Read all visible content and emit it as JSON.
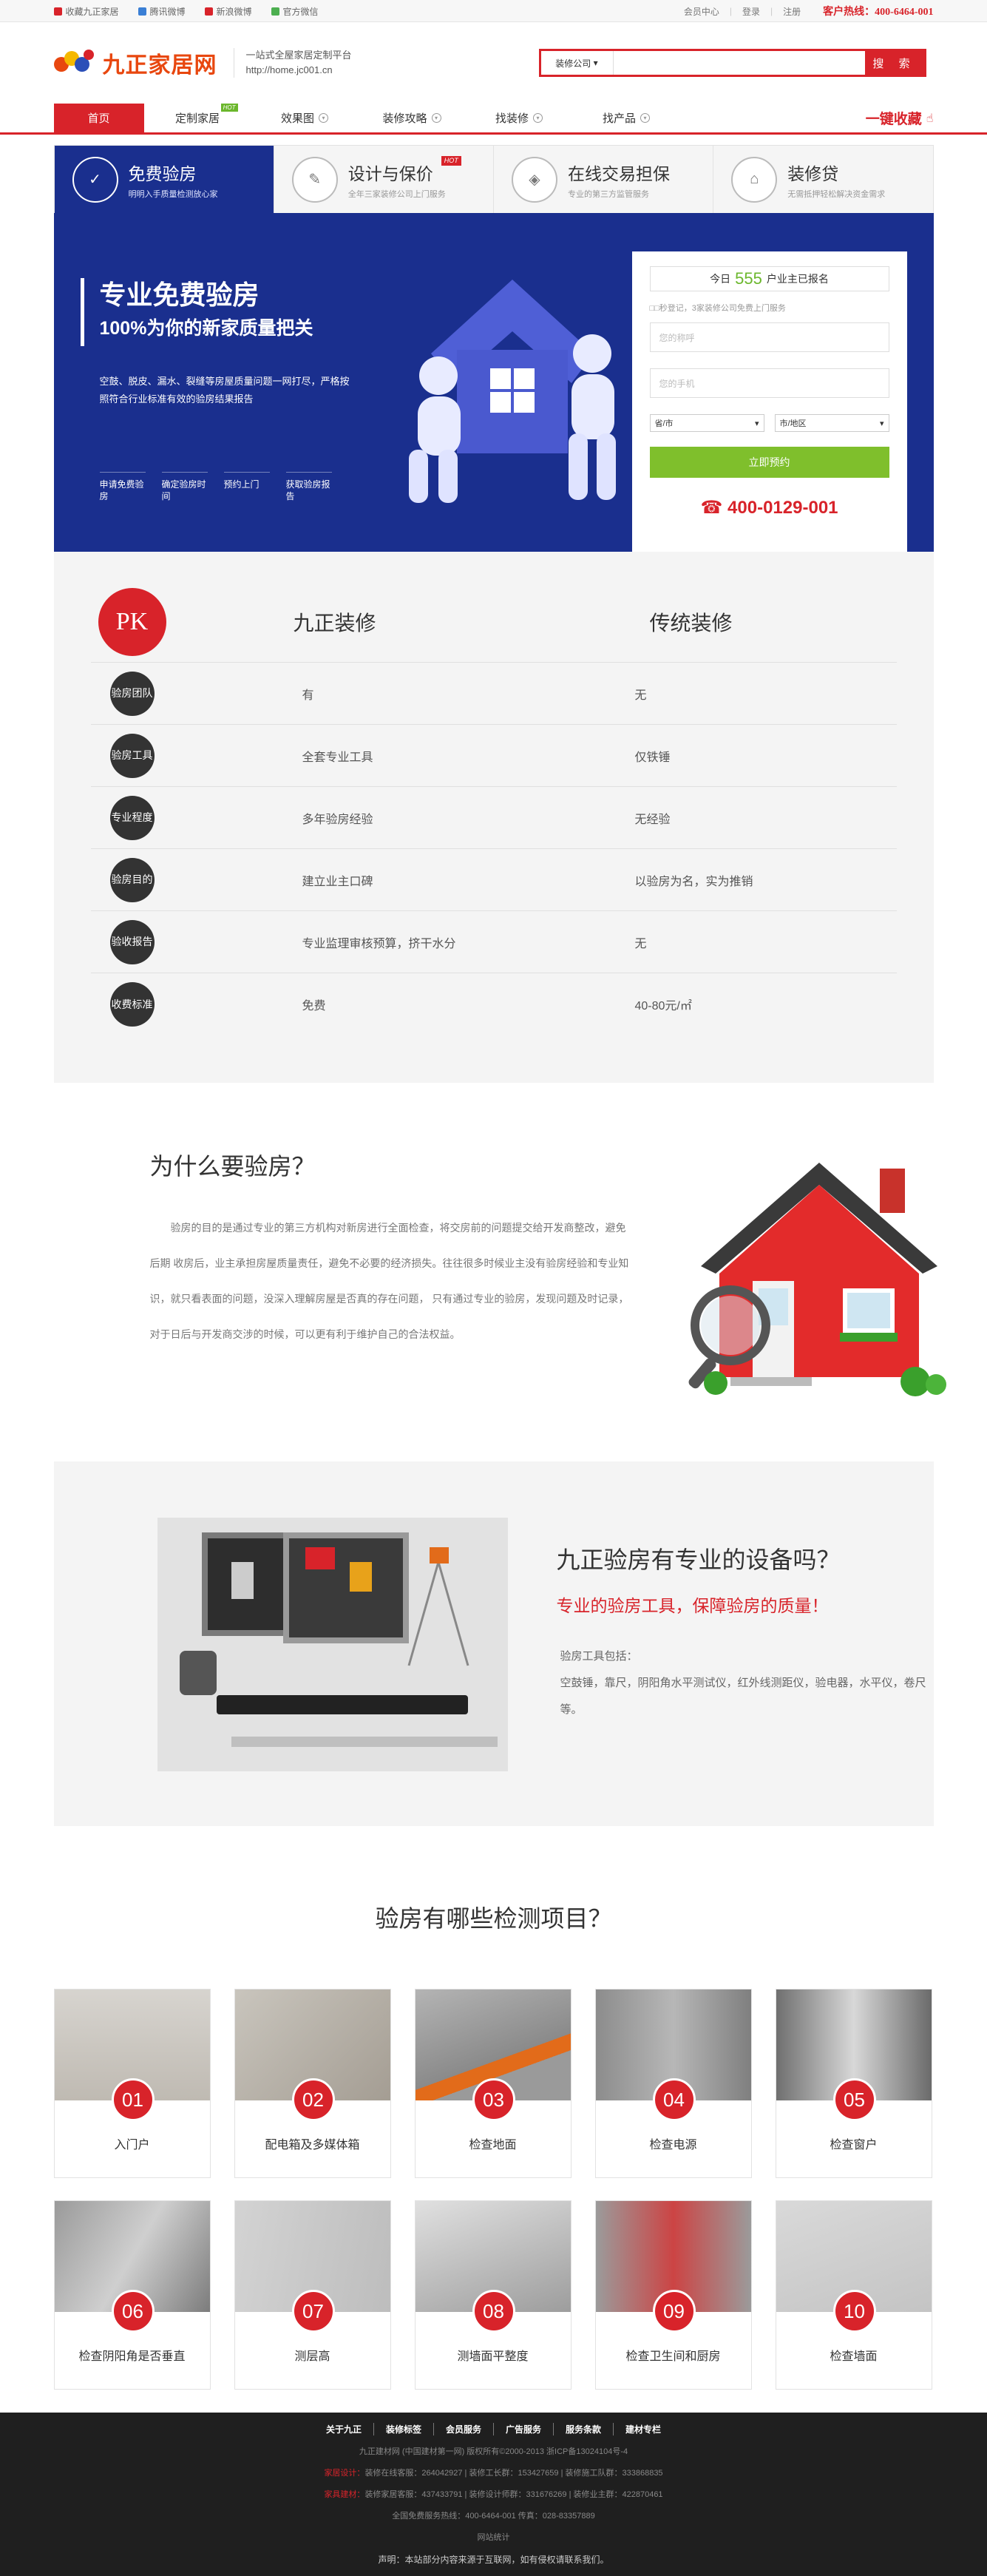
{
  "topbar": {
    "links": [
      {
        "label": "收藏九正家居",
        "color": "#d8232a"
      },
      {
        "label": "腾讯微博",
        "color": "#3a7fd5"
      },
      {
        "label": "新浪微博",
        "color": "#d8232a"
      },
      {
        "label": "官方微信",
        "color": "#4caf50"
      }
    ],
    "member_center": "会员中心",
    "login": "登录",
    "register": "注册",
    "hotline": "客户热线：400-6464-001"
  },
  "header": {
    "logo_text": "九正家居网",
    "slogan_1": "一站式全屋家居定制平台",
    "slogan_2": "http://home.jc001.cn",
    "search_select": "装修公司",
    "search_placeholder": "",
    "search_button": "搜 索"
  },
  "nav": {
    "items": [
      {
        "label": "首页"
      },
      {
        "label": "定制家居",
        "badge": "HOT"
      },
      {
        "label": "效果图"
      },
      {
        "label": "装修攻略"
      },
      {
        "label": "找装修"
      },
      {
        "label": "找产品"
      }
    ],
    "favorite": "一键收藏"
  },
  "service_tabs": [
    {
      "title": "免费验房",
      "sub": "明明入手质量检测放心家"
    },
    {
      "title": "设计与保价",
      "sub": "全年三家装修公司上门服务",
      "badge": "HOT"
    },
    {
      "title": "在线交易担保",
      "sub": "专业的第三方监管服务"
    },
    {
      "title": "装修贷",
      "sub": "无需抵押轻松解决资金需求"
    }
  ],
  "banner": {
    "title": "专业免费验房",
    "subtitle": "100%为你的新家质量把关",
    "desc": "空鼓、脱皮、漏水、裂缝等房屋质量问题一网打尽，严格按照符合行业标准有效的验房结果报告",
    "steps": [
      "申请免费验房",
      "确定验房时间",
      "预约上门",
      "获取验房报告"
    ]
  },
  "form": {
    "count_prefix": "今日",
    "count": "555",
    "count_suffix": "户业主已报名",
    "note": "□□秒登记，3家装修公司免费上门服务",
    "name_placeholder": "您的称呼",
    "phone_placeholder": "您的手机",
    "province": "省/市",
    "city": "市/地区",
    "submit": "立即预约",
    "phone": "☎ 400-0129-001"
  },
  "compare": {
    "pk": "PK",
    "col1": "九正装修",
    "col2": "传统装修",
    "rows": [
      {
        "label": "验房团队",
        "ours": "有",
        "theirs": "无"
      },
      {
        "label": "验房工具",
        "ours": "全套专业工具",
        "theirs": "仅铁锤"
      },
      {
        "label": "专业程度",
        "ours": "多年验房经验",
        "theirs": "无经验"
      },
      {
        "label": "验房目的",
        "ours": "建立业主口碑",
        "theirs": "以验房为名，实为推销"
      },
      {
        "label": "验收报告",
        "ours": "专业监理审核预算，挤干水分",
        "theirs": "无"
      },
      {
        "label": "收费标准",
        "ours": "免费",
        "theirs": "40-80元/㎡"
      }
    ]
  },
  "why": {
    "title": "为什么要验房？",
    "text": "验房的目的是通过专业的第三方机构对新房进行全面检查，将交房前的问题提交给开发商整改，避免后期 收房后，业主承担房屋质量责任，避免不必要的经济损失。往往很多时候业主没有验房经验和专业知识，就只看表面的问题，没深入理解房屋是否真的存在问题， 只有通过专业的验房，发现问题及时记录，对于日后与开发商交涉的时候，可以更有利于维护自己的合法权益。"
  },
  "equip": {
    "title": "九正验房有专业的设备吗？",
    "subtitle": "专业的验房工具，保障验房的质量！",
    "text_1": "验房工具包括：",
    "text_2": "空鼓锤，靠尺，阴阳角水平测试仪，红外线测距仪，验电器，水平仪，卷尺等。"
  },
  "items": {
    "title": "验房有哪些检测项目？",
    "list": [
      {
        "num": "01",
        "label": "入门户"
      },
      {
        "num": "02",
        "label": "配电箱及多媒体箱"
      },
      {
        "num": "03",
        "label": "检查地面"
      },
      {
        "num": "04",
        "label": "检查电源"
      },
      {
        "num": "05",
        "label": "检查窗户"
      },
      {
        "num": "06",
        "label": "检查阴阳角是否垂直"
      },
      {
        "num": "07",
        "label": "测层高"
      },
      {
        "num": "08",
        "label": "测墙面平整度"
      },
      {
        "num": "09",
        "label": "检查卫生间和厨房"
      },
      {
        "num": "10",
        "label": "检查墙面"
      }
    ]
  },
  "footer": {
    "links": [
      "关于九正",
      "装修标签",
      "会员服务",
      "广告服务",
      "服务条款",
      "建材专栏"
    ],
    "line1": "九正建材网 (中国建材第一网) 版权所有©2000-2013   浙ICP备13024104号-4",
    "line2_label": "家居设计：",
    "line2": "装修在线客服：264042927 | 装修工长群：153427659 | 装修施工队群：333868835",
    "line3_label": "家具建材：",
    "line3": "装修家居客服：437433791 | 装修设计师群：331676269 | 装修业主群：422870461",
    "line4": "全国免费服务热线：400-6464-001 传真：028-83357889",
    "line5": "网站统计",
    "decl": "声明：本站部分内容来源于互联网，如有侵权请联系我们。"
  }
}
